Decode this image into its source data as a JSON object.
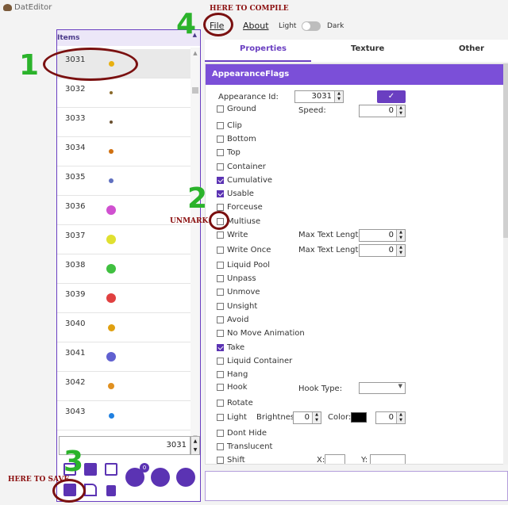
{
  "app": {
    "title": "DatEditor"
  },
  "menu": {
    "file": "File",
    "about": "About",
    "light": "Light",
    "dark": "Dark"
  },
  "items_panel": {
    "header": "Items",
    "rows": [
      {
        "id": "3031",
        "color": "#e8b010",
        "selected": true
      },
      {
        "id": "3032",
        "color": "#8a6a2a"
      },
      {
        "id": "3033",
        "color": "#6a5030"
      },
      {
        "id": "3034",
        "color": "#d07010"
      },
      {
        "id": "3035",
        "color": "#6070c0"
      },
      {
        "id": "3036",
        "color": "#d050d0"
      },
      {
        "id": "3037",
        "color": "#e0e030"
      },
      {
        "id": "3038",
        "color": "#40c040"
      },
      {
        "id": "3039",
        "color": "#e04040"
      },
      {
        "id": "3040",
        "color": "#e0a010"
      },
      {
        "id": "3041",
        "color": "#6060d0"
      },
      {
        "id": "3042",
        "color": "#e09020"
      },
      {
        "id": "3043",
        "color": "#2080e0"
      }
    ],
    "id_value": "3031",
    "badge_count": "0"
  },
  "tabs": {
    "properties": "Properties",
    "texture": "Texture",
    "other": "Other"
  },
  "flags_panel": {
    "header": "AppearanceFlags",
    "appearance_id_label": "Appearance Id:",
    "appearance_id_value": "3031",
    "speed_label": "Speed:",
    "speed_value": "0",
    "max_text_length_label": "Max Text Length:",
    "max_text_length_value": "0",
    "max_text_length_value_2": "0",
    "hook_type_label": "Hook Type:",
    "brightness_label": "Brightness",
    "brightness_value": "0",
    "color_label": "Color:",
    "color_value": "0",
    "shift_x_label": "X:",
    "shift_y_label": "Y:",
    "flags": [
      {
        "label": "Ground",
        "checked": false
      },
      {
        "label": "Clip",
        "checked": false
      },
      {
        "label": "Bottom",
        "checked": false
      },
      {
        "label": "Top",
        "checked": false
      },
      {
        "label": "Container",
        "checked": false
      },
      {
        "label": "Cumulative",
        "checked": true
      },
      {
        "label": "Usable",
        "checked": true
      },
      {
        "label": "Forceuse",
        "checked": false
      },
      {
        "label": "Multiuse",
        "checked": false
      },
      {
        "label": "Write",
        "checked": false
      },
      {
        "label": "Write Once",
        "checked": false
      },
      {
        "label": "Liquid Pool",
        "checked": false
      },
      {
        "label": "Unpass",
        "checked": false
      },
      {
        "label": "Unmove",
        "checked": false
      },
      {
        "label": "Unsight",
        "checked": false
      },
      {
        "label": "Avoid",
        "checked": false
      },
      {
        "label": "No Move Animation",
        "checked": false
      },
      {
        "label": "Take",
        "checked": true
      },
      {
        "label": "Liquid Container",
        "checked": false
      },
      {
        "label": "Hang",
        "checked": false
      },
      {
        "label": "Hook",
        "checked": false
      },
      {
        "label": "Rotate",
        "checked": false
      },
      {
        "label": "Light",
        "checked": false
      },
      {
        "label": "Dont Hide",
        "checked": false
      },
      {
        "label": "Translucent",
        "checked": false
      },
      {
        "label": "Shift",
        "checked": false
      }
    ]
  },
  "annotations": {
    "here_to_compile": "HERE TO COMPILE",
    "here_to_save": "HERE TO SAVE",
    "unmark": "UNMARK",
    "n1": "1",
    "n2": "2",
    "n3": "3",
    "n4": "4"
  }
}
